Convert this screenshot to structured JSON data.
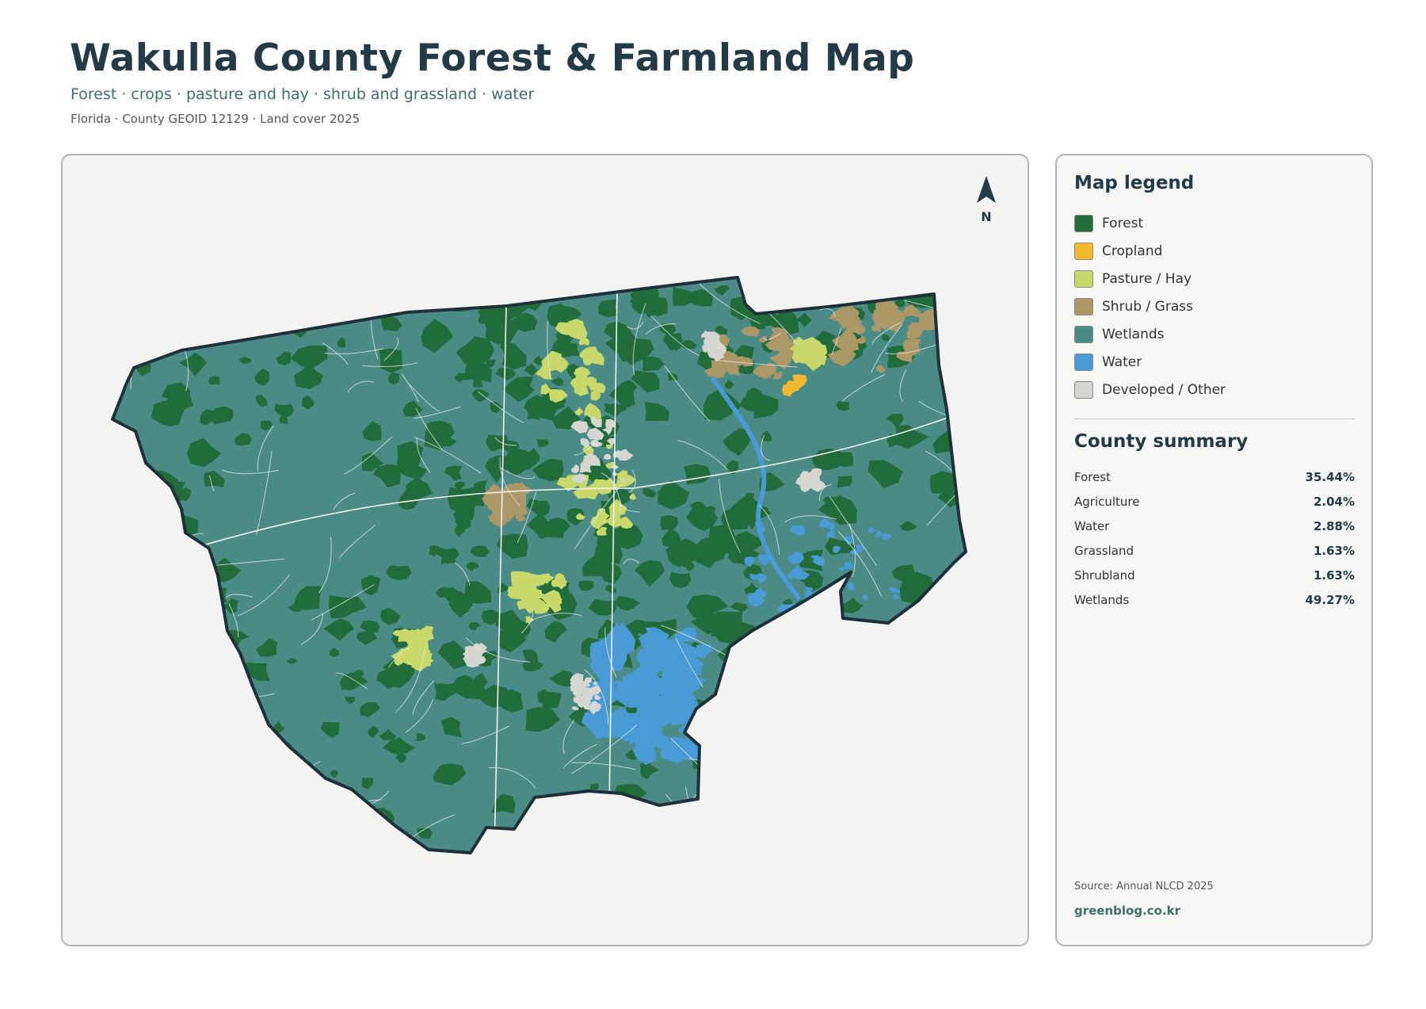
{
  "header": {
    "title": "Wakulla County Forest & Farmland Map",
    "subtitle": "Forest · crops · pasture and hay · shrub and grassland · water",
    "meta": "Florida · County GEOID 12129 · Land cover 2025"
  },
  "map": {
    "north_label": "N",
    "colors": {
      "forest": "#226b3b",
      "cropland": "#f0b92e",
      "pasture": "#c9d86a",
      "shrub": "#ac9766",
      "wetlands": "#4b8b86",
      "water": "#4a9ad6",
      "developed": "#d6d6d2",
      "outline": "#1e313a"
    }
  },
  "legend": {
    "title": "Map legend",
    "items": [
      {
        "label": "Forest",
        "color": "#226b3b"
      },
      {
        "label": "Cropland",
        "color": "#f0b92e"
      },
      {
        "label": "Pasture / Hay",
        "color": "#c9d86a"
      },
      {
        "label": "Shrub / Grass",
        "color": "#ac9766"
      },
      {
        "label": "Wetlands",
        "color": "#4b8b86"
      },
      {
        "label": "Water",
        "color": "#4a9ad6"
      },
      {
        "label": "Developed / Other",
        "color": "#d4d4d0"
      }
    ]
  },
  "summary": {
    "title": "County summary",
    "rows": [
      {
        "label": "Forest",
        "value": "35.44%"
      },
      {
        "label": "Agriculture",
        "value": "2.04%"
      },
      {
        "label": "Water",
        "value": "2.88%"
      },
      {
        "label": "Grassland",
        "value": "1.63%"
      },
      {
        "label": "Shrubland",
        "value": "1.63%"
      },
      {
        "label": "Wetlands",
        "value": "49.27%"
      }
    ]
  },
  "footer": {
    "source": "Source: Annual NLCD 2025",
    "site": "greenblog.co.kr"
  }
}
